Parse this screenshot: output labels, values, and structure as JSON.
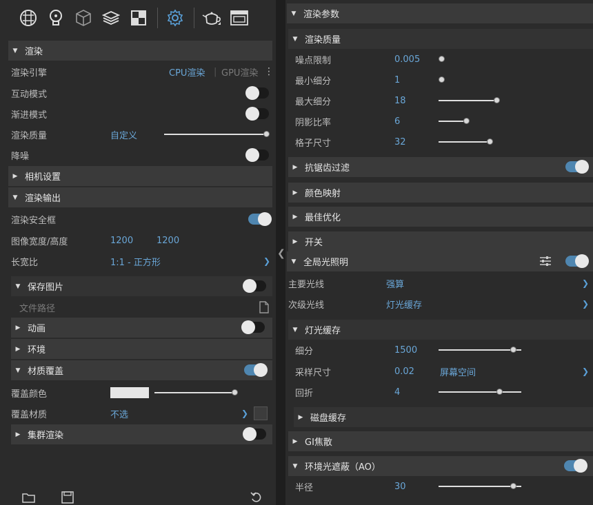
{
  "left": {
    "render": {
      "title": "渲染",
      "engine_label": "渲染引擎",
      "cpu": "CPU渲染",
      "gpu": "GPU渲染",
      "interactive_label": "互动模式",
      "progressive_label": "渐进模式",
      "quality_label": "渲染质量",
      "quality_value": "自定义",
      "denoise_label": "降噪"
    },
    "camera_title": "相机设置",
    "output": {
      "title": "渲染输出",
      "safe_frame_label": "渲染安全框",
      "size_label": "图像宽度/高度",
      "width": "1200",
      "height": "1200",
      "aspect_label": "长宽比",
      "aspect_value": "1:1 - 正方形",
      "save_image_label": "保存图片",
      "file_path_placeholder": "文件路径"
    },
    "animation_title": "动画",
    "environment_title": "环境",
    "material_override": {
      "title": "材质覆盖",
      "color_label": "覆盖颜色",
      "material_label": "覆盖材质",
      "material_value": "不选"
    },
    "cluster_title": "集群渲染"
  },
  "right": {
    "params_title": "渲染参数",
    "quality": {
      "title": "渲染质量",
      "rows": [
        {
          "label": "噪点限制",
          "value": "0.005",
          "level": 0.0
        },
        {
          "label": "最小细分",
          "value": "1",
          "level": 0.0
        },
        {
          "label": "最大细分",
          "value": "18",
          "level": 0.4
        },
        {
          "label": "阴影比率",
          "value": "6",
          "level": 0.18
        },
        {
          "label": "格子尺寸",
          "value": "32",
          "level": 0.35
        }
      ]
    },
    "aa_title": "抗锯齿过滤",
    "color_map_title": "颜色映射",
    "optimize_title": "最佳优化",
    "switch_title": "开关",
    "gi": {
      "title": "全局光照明",
      "primary_label": "主要光线",
      "primary_value": "强算",
      "secondary_label": "次级光线",
      "secondary_value": "灯光缓存"
    },
    "light_cache": {
      "title": "灯光缓存",
      "subdiv_label": "细分",
      "subdiv_value": "1500",
      "sample_label": "采样尺寸",
      "sample_value": "0.02",
      "sample_mode": "屏幕空间",
      "bounce_label": "回折",
      "bounce_value": "4",
      "disk_cache_title": "磁盘缓存"
    },
    "caustics_title": "GI焦散",
    "ao": {
      "title": "环境光遮蔽（AO）",
      "radius_label": "半径",
      "radius_value": "30"
    }
  },
  "colors": {
    "accent": "#6aa7d8",
    "toggle_on": "#4f86b0",
    "panel_bg": "#2b2b2b",
    "header_bg": "#3a3a3a"
  },
  "icons": [
    "sphere-icon",
    "light-icon",
    "cube-icon",
    "layers-icon",
    "checker-icon",
    "gear-icon",
    "teapot-icon",
    "window-icon",
    "folder-icon",
    "save-icon",
    "undo-icon",
    "file-icon",
    "menu-dots-icon",
    "sliders-icon",
    "chevron-down-icon"
  ]
}
